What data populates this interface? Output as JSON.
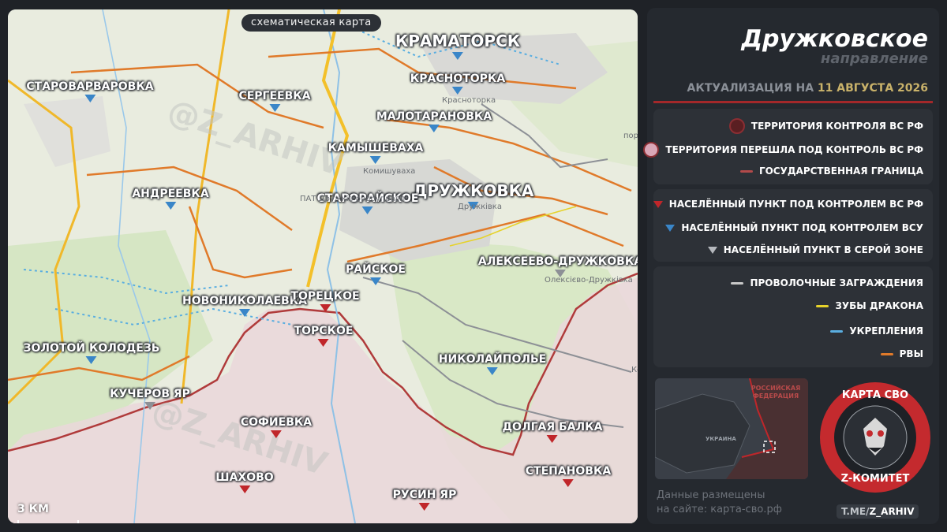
{
  "map": {
    "badge": "схематическая карта",
    "scale_label": "3 КМ",
    "towns": [
      {
        "name": "КРАМАТОРСК",
        "status": "ua",
        "size": "big"
      },
      {
        "name": "ДРУЖКОВКА",
        "status": "ua",
        "size": "big"
      },
      {
        "name": "СТАРОВАРВАРОВКА",
        "status": "ua"
      },
      {
        "name": "СЕРГЕЕВКА",
        "status": "ua"
      },
      {
        "name": "КРАСНОТОРКА",
        "status": "ua"
      },
      {
        "name": "МАЛОТАРАНОВКА",
        "status": "ua"
      },
      {
        "name": "КАМЫШЕВАХА",
        "status": "ua"
      },
      {
        "name": "АНДРЕЕВКА",
        "status": "ua"
      },
      {
        "name": "СТАРОРАЙСКОЕ",
        "status": "ua"
      },
      {
        "name": "РАЙСКОЕ",
        "status": "ua"
      },
      {
        "name": "АЛЕКСЕЕВО-ДРУЖКОВКА",
        "status": "grey"
      },
      {
        "name": "НОВОНИКОЛАЕВКА",
        "status": "ua"
      },
      {
        "name": "ТОРЕЦКОЕ",
        "status": "rf"
      },
      {
        "name": "ТОРСКОЕ",
        "status": "rf"
      },
      {
        "name": "ЗОЛОТОЙ КОЛОДЕЗЬ",
        "status": "ua"
      },
      {
        "name": "НИКОЛАЙПОЛЬЕ",
        "status": "ua"
      },
      {
        "name": "КУЧЕРОВ ЯР",
        "status": "grey"
      },
      {
        "name": "СОФИЕВКА",
        "status": "rf"
      },
      {
        "name": "ДОЛГАЯ БАЛКА",
        "status": "rf"
      },
      {
        "name": "СТЕПАНОВКА",
        "status": "rf"
      },
      {
        "name": "ШАХОВО",
        "status": "rf"
      },
      {
        "name": "РУСИН ЯР",
        "status": "rf"
      }
    ],
    "underlay_labels": [
      "Краснотoрка",
      "Комишуваха",
      "Дружківка",
      "ПАТ Дружків рудоуправл",
      "Олексієво-Дружківка",
      "Кост",
      "пор"
    ]
  },
  "panel": {
    "title": "Дружковское",
    "subtitle": "направление",
    "date_prefix": "АКТУАЛИЗАЦИЯ НА ",
    "date_value": "11 АВГУСТА 2026",
    "legend_territory": [
      {
        "label": "ТЕРРИТОРИЯ КОНТРОЛЯ ВС РФ",
        "symbol": "dot",
        "color": "#5a1f22"
      },
      {
        "label": "ТЕРРИТОРИЯ ПЕРЕШЛА ПОД КОНТРОЛЬ ВС РФ",
        "symbol": "dot",
        "color": "#d9a7b7"
      },
      {
        "label": "ГОСУДАРСТВЕННАЯ ГРАНИЦА",
        "symbol": "line",
        "color": "#b24a4a"
      }
    ],
    "legend_settlements": [
      {
        "label": "НАСЕЛЁННЫЙ ПУНКТ ПОД КОНТРОЛЕМ ВС РФ",
        "color": "#c0262a"
      },
      {
        "label": "НАСЕЛЁННЫЙ ПУНКТ ПОД КОНТРОЛЕМ ВСУ",
        "color": "#3a86c8"
      },
      {
        "label": "НАСЕЛЁННЫЙ ПУНКТ В СЕРОЙ ЗОНЕ",
        "color": "#b5b8bd"
      }
    ],
    "legend_fortifications": [
      {
        "label": "ПРОВОЛОЧНЫЕ ЗАГРАЖДЕНИЯ",
        "color": "#c8c8c8"
      },
      {
        "label": "ЗУБЫ ДРАКОНА",
        "color": "#e6d22a"
      },
      {
        "label": "УКРЕПЛЕНИЯ",
        "color": "#5aaee0"
      },
      {
        "label": "РВЫ",
        "color": "#e07a2a"
      }
    ],
    "minimap": {
      "label_ru": "РОССИЙСКАЯ ФЕДЕРАЦИЯ",
      "label_ua": "УКРАИНА"
    },
    "site_note_line1": "Данные размещены",
    "site_note_line2": "на сайте: карта-сво.рф",
    "emblem_top": "КАРТА СВО",
    "emblem_bottom": "Z-КОМИТЕТ",
    "tg_prefix": "T.ME/",
    "tg_handle": "Z_ARHIV"
  }
}
